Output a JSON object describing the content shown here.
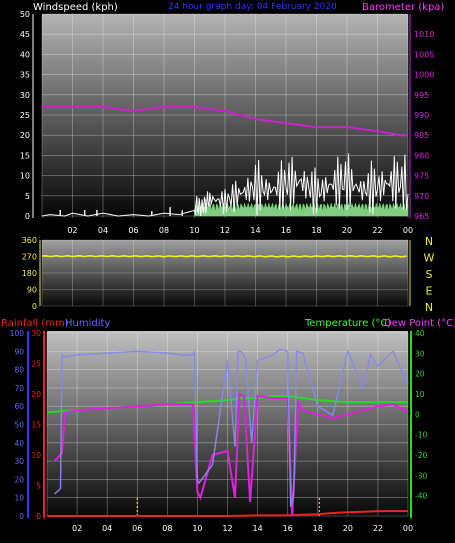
{
  "header": {
    "top_title": "24 hour graph day: 04 February 2020"
  },
  "chart_data": [
    {
      "type": "line",
      "title": "24 hour graph day: 04 February 2020",
      "ylabel_left": "Windspeed (kph)",
      "ylabel_right": "Barometer (kpa)",
      "ylim_left": [
        0,
        50
      ],
      "ylim_right": [
        965,
        1015
      ],
      "left_ticks": [
        "0",
        "5",
        "10",
        "15",
        "20",
        "25",
        "30",
        "35",
        "40",
        "45",
        "50"
      ],
      "right_ticks": [
        "965",
        "970",
        "975",
        "980",
        "985",
        "990",
        "995",
        "1000",
        "1005",
        "1010"
      ],
      "x_ticks": [
        "02",
        "04",
        "06",
        "08",
        "10",
        "12",
        "14",
        "16",
        "18",
        "20",
        "22",
        "00"
      ],
      "grid": true,
      "colors": {
        "barometer": "#cc22cc",
        "wind": "#ffffff",
        "gust_fill": "#99ee99",
        "left_axis": "#ffffff",
        "right_axis": "#dd22dd"
      },
      "series": [
        {
          "name": "Barometer (kpa)",
          "axis": "right",
          "x": [
            0,
            2,
            4,
            6,
            8,
            10,
            12,
            14,
            16,
            18,
            20,
            22,
            23.5,
            24
          ],
          "values": [
            992,
            992,
            992,
            991,
            992,
            992,
            991,
            989,
            988,
            987,
            987,
            986,
            985,
            985
          ]
        },
        {
          "name": "Windspeed (kph)",
          "axis": "left",
          "x": [
            0,
            0.5,
            1.5,
            2,
            3,
            3.5,
            4,
            5,
            6,
            7,
            8,
            9,
            10,
            10.5,
            11,
            12,
            13,
            14,
            15,
            16,
            17,
            18,
            19,
            20,
            21,
            22,
            23,
            24
          ],
          "values": [
            0,
            1,
            0,
            2,
            0,
            1,
            2,
            0,
            1,
            0,
            2,
            1,
            4,
            3,
            6,
            5,
            8,
            10,
            9,
            11,
            12,
            8,
            11,
            12,
            9,
            10,
            12,
            11
          ]
        }
      ]
    },
    {
      "type": "line",
      "ylabel_right_compass": [
        "N",
        "W",
        "S",
        "E",
        "N"
      ],
      "ylim": [
        0,
        360
      ],
      "left_ticks": [
        "0",
        "90",
        "180",
        "270",
        "360"
      ],
      "grid": true,
      "colors": {
        "direction": "#eeee22",
        "left_axis": "#eeee55"
      },
      "series": [
        {
          "name": "Wind direction",
          "x": [
            0,
            4,
            8,
            12,
            16,
            20,
            24
          ],
          "values": [
            272,
            272,
            271,
            272,
            270,
            272,
            270
          ]
        }
      ]
    },
    {
      "type": "line",
      "ylabel_left_rain": "Rainfall (mm)",
      "ylabel_left_humidity": "Humidity",
      "ylabel_right_temp": "Temperature (°C)",
      "ylabel_right_dew": "Dew Point (°C)",
      "ylim_humidity": [
        0,
        100
      ],
      "ylim_rain": [
        0,
        30
      ],
      "ylim_temp": [
        -50,
        40
      ],
      "humidity_ticks": [
        "0",
        "10",
        "20",
        "30",
        "40",
        "50",
        "60",
        "70",
        "80",
        "90",
        "100"
      ],
      "rain_ticks": [
        "0",
        "5",
        "10",
        "15",
        "20",
        "25",
        "30"
      ],
      "temp_ticks": [
        "-40",
        "-30",
        "-20",
        "-10",
        "0",
        "10",
        "20",
        "30",
        "40"
      ],
      "x_ticks": [
        "02",
        "04",
        "06",
        "08",
        "10",
        "12",
        "14",
        "16",
        "18",
        "20",
        "22",
        "00"
      ],
      "grid": true,
      "colors": {
        "humidity": "#8888ee",
        "temperature": "#22dd22",
        "dewpoint": "#dd22dd",
        "rain": "#ee2222",
        "rain_label": "#ee2222",
        "humidity_label": "#6666ff",
        "temp_label": "#33ff33",
        "dew_label": "#ff33ff",
        "marker": "#ffff33"
      },
      "series": [
        {
          "name": "Humidity",
          "axis": "humidity",
          "x": [
            0.5,
            0.9,
            1.0,
            1.2,
            2,
            4,
            6,
            8,
            9,
            9.7,
            9.8,
            10.0,
            10.1,
            11,
            12,
            12.5,
            12.7,
            12.9,
            13.2,
            13.6,
            14,
            15,
            15.5,
            16,
            16.2,
            16.4,
            16.6,
            17,
            18,
            19,
            20,
            21,
            21.5,
            22,
            23,
            24
          ],
          "values": [
            12,
            15,
            88,
            87,
            88,
            89,
            90,
            89,
            88,
            88,
            90,
            20,
            18,
            28,
            85,
            38,
            90,
            90,
            86,
            40,
            85,
            88,
            91,
            90,
            5,
            12,
            90,
            89,
            60,
            55,
            90,
            70,
            88,
            82,
            90,
            72
          ]
        },
        {
          "name": "Temperature (°C)",
          "axis": "temp",
          "x": [
            0,
            2,
            4,
            6,
            8,
            10,
            12,
            13,
            14,
            15,
            16,
            17,
            18,
            20,
            22,
            24
          ],
          "values": [
            1,
            2,
            3,
            4,
            5,
            6,
            7,
            8,
            8,
            9,
            9,
            8,
            7,
            6,
            6,
            6
          ]
        },
        {
          "name": "Dew Point (°C)",
          "axis": "temp",
          "x": [
            0.5,
            1.0,
            1.2,
            2,
            4,
            6,
            8,
            9.7,
            10.0,
            10.2,
            11,
            12,
            12.5,
            12.8,
            13.1,
            13.5,
            14,
            15,
            16,
            16.3,
            16.7,
            17,
            18,
            19,
            20,
            21,
            22,
            23,
            24
          ],
          "values": [
            -23,
            -19,
            1,
            2,
            3,
            4,
            5,
            5,
            -38,
            -41,
            -20,
            -18,
            -41,
            10,
            9,
            -43,
            9,
            8,
            8,
            -50,
            6,
            2,
            0,
            -2,
            0,
            2,
            4,
            5,
            1
          ]
        },
        {
          "name": "Rainfall (mm)",
          "axis": "rain",
          "x": [
            0,
            6,
            12,
            14,
            15,
            16,
            17,
            18,
            19,
            20,
            21,
            22,
            23,
            24
          ],
          "values": [
            0,
            0,
            0,
            0.1,
            0.1,
            0.1,
            0.2,
            0.3,
            0.5,
            0.6,
            0.7,
            0.8,
            0.8,
            0.8
          ]
        }
      ],
      "markers_x": [
        6.0,
        18.1
      ]
    }
  ]
}
